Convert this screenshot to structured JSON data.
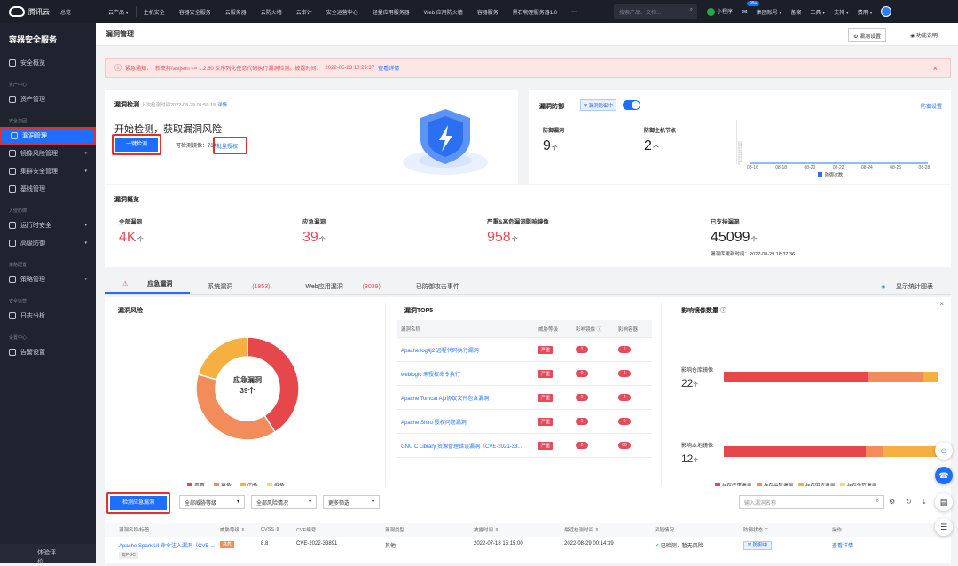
{
  "topbar": {
    "logo": "腾讯云",
    "home": "总览",
    "nav": [
      "云产品 ▾",
      "主机安全",
      "容器安全服务",
      "云服务器",
      "云防火墙",
      "云审计",
      "安全运营中心",
      "轻量应用服务器",
      "Web 应用防火墙",
      "容器服务",
      "黑石物理服务器1.0",
      "···"
    ],
    "search_placeholder": "搜索产品、文档...",
    "mini_program": "小程序",
    "badge": "99+",
    "group_account": "集团账号 ▾",
    "beian": "备案",
    "tools": "工具 ▾",
    "support": "支持 ▾",
    "billing": "费用 ▾"
  },
  "sidebar": {
    "title": "容器安全服务",
    "items": [
      {
        "group": "",
        "label": "安全概览",
        "arrow": ""
      },
      {
        "group": "资产中心",
        "label": "资产管理",
        "arrow": ""
      },
      {
        "group": "安全加固",
        "label": "漏洞管理",
        "arrow": "",
        "active": true
      },
      {
        "group": "",
        "label": "镜像风险管理",
        "arrow": "▾"
      },
      {
        "group": "",
        "label": "集群安全管理",
        "arrow": "▾"
      },
      {
        "group": "",
        "label": "基线管理",
        "arrow": ""
      },
      {
        "group": "入侵防御",
        "label": "运行时安全",
        "arrow": "▾"
      },
      {
        "group": "",
        "label": "高级防御",
        "arrow": "▾"
      },
      {
        "group": "策略配置",
        "label": "策略管理",
        "arrow": "▾"
      },
      {
        "group": "安全运营",
        "label": "日志分析",
        "arrow": ""
      },
      {
        "group": "设置中心",
        "label": "告警设置",
        "arrow": ""
      }
    ],
    "footer": "体验评价"
  },
  "header": {
    "title": "漏洞管理",
    "settings_btn": "漏洞设置",
    "help_btn": "功能说明"
  },
  "alert": {
    "prefix": "紧急通知：",
    "text": "新支持fastjson <= 1.2.80 反序列化任意代码执行漏洞检测。披露时间：",
    "time": "2022-05-23 10:29:37",
    "link": "查看详情"
  },
  "scan": {
    "title": "漏洞检测",
    "last_label": "上次检测时间2022-08-29 01:56:18",
    "detail_link": "详情",
    "headline": "开始检测，获取漏洞风险",
    "btn": "一键检测",
    "count_label": "可检测镜像：",
    "count": "734",
    "auth_link": "批量授权"
  },
  "defense": {
    "title": "漏洞防御",
    "status": "漏洞防御中",
    "settings_link": "防御设置",
    "vuln_label": "防御漏洞",
    "vuln_value": "9",
    "node_label": "防御主机节点",
    "node_value": "2",
    "unit": "个",
    "chart_yticks": [
      "1.0",
      "0.9",
      "0.8",
      "0.7",
      "0.6",
      "0.5",
      "0.4",
      "0.3",
      "0.2",
      "0.1",
      "0"
    ],
    "chart_xticks": [
      "08-16",
      "08-18",
      "08-20",
      "08-22",
      "08-24",
      "08-26",
      "08-28"
    ],
    "chart_legend": "防御次数"
  },
  "overview": {
    "title": "漏洞概览",
    "items": [
      {
        "label": "全部漏洞",
        "value": "4K",
        "unit": "个"
      },
      {
        "label": "应急漏洞",
        "value": "39",
        "unit": "个"
      },
      {
        "label": "严重&高危漏洞影响镜像",
        "value": "958",
        "unit": "个"
      },
      {
        "label": "已支持漏洞",
        "value": "45099",
        "unit": "个"
      }
    ],
    "update_label": "漏洞库更新时间：",
    "update_time": "2022-08-29 18:37:36"
  },
  "tabs": {
    "items": [
      {
        "label": "应急漏洞",
        "count": ""
      },
      {
        "label": "系统漏洞",
        "count": "(1853)"
      },
      {
        "label": "Web应用漏洞",
        "count": "(3039)"
      },
      {
        "label": "已防御攻击事件",
        "count": ""
      }
    ],
    "right_link": "显示统计图表"
  },
  "risk": {
    "title": "漏洞风险",
    "center_title": "应急漏洞",
    "center_value": "39个",
    "legend": [
      {
        "label": "严重",
        "color": "#e5474b"
      },
      {
        "label": "高危",
        "color": "#f28c5a"
      },
      {
        "label": "中危",
        "color": "#f5b041"
      },
      {
        "label": "低危",
        "color": "#f7d774"
      }
    ]
  },
  "chart_data": {
    "type": "pie",
    "categories": [
      "严重",
      "高危",
      "中危",
      "低危"
    ],
    "values": [
      16,
      15,
      8,
      0
    ]
  },
  "top5": {
    "title": "漏洞TOP5",
    "headers": [
      "漏洞名称",
      "威胁等级",
      "影响镜像 ⓘ",
      "影响容器"
    ],
    "rows": [
      {
        "name": "Apache log4j2 远程代码执行漏洞",
        "level": "严重",
        "images": "1",
        "containers": "1"
      },
      {
        "name": "weblogic 未授权命令执行",
        "level": "严重",
        "images": "0",
        "containers": "3"
      },
      {
        "name": "Apache Tomcat Ajp协议文件包含漏洞",
        "level": "严重",
        "images": "1",
        "containers": "2"
      },
      {
        "name": "Apache Shiro 授权问题漏洞",
        "level": "严重",
        "images": "1",
        "containers": "0"
      },
      {
        "name": "GNU C Library 资源管理错误漏洞（CVE-2021-33...",
        "level": "严重",
        "images": "2",
        "containers": "80"
      }
    ]
  },
  "impact": {
    "title": "影响镜像数量",
    "local_label": "影响仓库镜像",
    "local_value": "22",
    "node_label": "影响本地镜像",
    "node_value": "12",
    "unit": "个",
    "legend": [
      "存在严重漏洞",
      "存在高危漏洞",
      "存在中危漏洞",
      "存在低危漏洞"
    ],
    "bar1": [
      0.67,
      0.26,
      0.07,
      0
    ],
    "bar2": [
      0.66,
      0.08,
      0.26,
      0
    ]
  },
  "list": {
    "check_btn": "检测应急漏洞",
    "filter1": "全部威胁等级",
    "filter2": "全部风险情况",
    "filter3": "更多筛选",
    "search_placeholder": "输入漏洞名称",
    "headers": [
      "漏洞名称/标签",
      "威胁等级 ⇕",
      "CVSS ⇕",
      "CVE编号",
      "漏洞类型",
      "披露时间 ⇕",
      "最近检测时间 ⇕",
      "风险情况",
      "防御状态 ⊤",
      "操作"
    ],
    "row": {
      "name": "Apache Spark UI 命令注入漏洞（CVE-...",
      "tag": "有POC",
      "level": "高危",
      "cvss": "8.8",
      "cve": "CVE-2022-33891",
      "type": "其他",
      "disclosed": "2022-07-18 15:15:00",
      "checked": "2022-08-29 00:14:39",
      "risk": "已检测，暂无风险",
      "defense": "防御中",
      "action": "查看详情"
    }
  }
}
